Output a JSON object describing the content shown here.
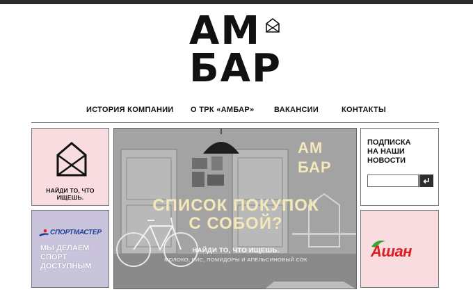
{
  "logo": {
    "line1": "АМ",
    "line2": "БАР"
  },
  "nav": {
    "items": [
      {
        "label": "ИСТОРИЯ КОМПАНИИ"
      },
      {
        "label": "О ТРК «АМБАР»"
      },
      {
        "label": "ВАКАНСИИ"
      },
      {
        "label": "КОНТАКТЫ"
      }
    ]
  },
  "tiles": {
    "search": {
      "caption": "НАЙДИ ТО, ЧТО ИЩЕШЬ."
    },
    "sport": {
      "brand": "СПОРТМАСТЕР",
      "slogan_line1": "МЫ ДЕЛАЕМ",
      "slogan_line2": "СПОРТ",
      "slogan_line3": "ДОСТУПНЫМ"
    },
    "hero": {
      "title_line1": "СПИСОК ПОКУПОК",
      "title_line2": "С СОБОЙ?",
      "subtitle": "НАЙДИ ТО, ЧТО ИЩЕШЬ.",
      "subline": "МОЛОКО, РИС, ПОМИДОРЫ И АПЕЛЬСИНОВЫЙ СОК",
      "logo_line1": "АМ",
      "logo_line2": "БАР"
    },
    "subscribe": {
      "title_line1": "ПОДПИСКА",
      "title_line2": "НА НАШИ",
      "title_line3": "НОВОСТИ",
      "input_value": "",
      "button_icon": "enter-arrow-icon"
    },
    "auchan": {
      "brand": "Ашан"
    }
  },
  "colors": {
    "pink_tile": "#f9dcdf",
    "lavender_tile": "#c9c4dc",
    "hero_text": "#f4e7b8",
    "auchan_red": "#e11b22",
    "auchan_green": "#3aa535",
    "sport_blue": "#1f3f96",
    "top_bar": "#2b2b2b"
  }
}
